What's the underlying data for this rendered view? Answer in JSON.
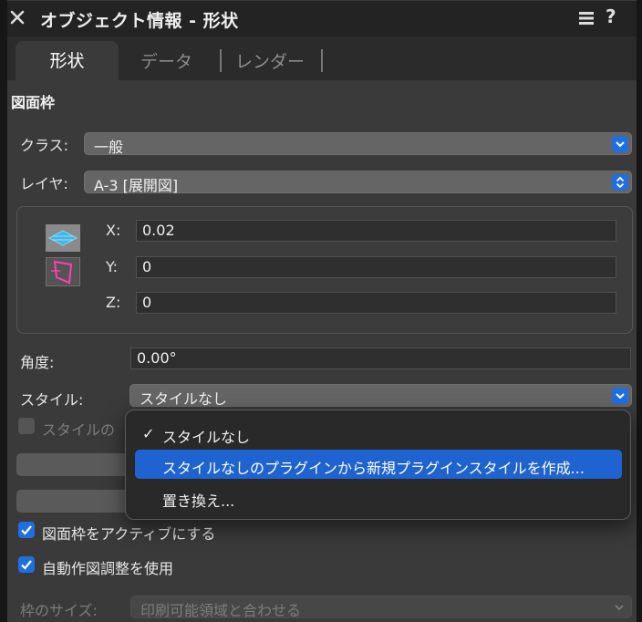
{
  "window": {
    "title": "オブジェクト情報 - 形状"
  },
  "tabs": [
    {
      "label": "形状"
    },
    {
      "label": "データ"
    },
    {
      "label": "レンダー"
    }
  ],
  "section": {
    "title": "図面枠"
  },
  "class_field": {
    "label": "クラス:",
    "value": "一般"
  },
  "layer_field": {
    "label": "レイヤ:",
    "value": "A-3 [展開図]"
  },
  "coords": {
    "x": {
      "label": "X:",
      "value": "0.02"
    },
    "y": {
      "label": "Y:",
      "value": "0"
    },
    "z": {
      "label": "Z:",
      "value": "0"
    }
  },
  "angle": {
    "label": "角度:",
    "value": "0.00°"
  },
  "style": {
    "label": "スタイル:",
    "value": "スタイルなし"
  },
  "style_checkbox": {
    "label": "スタイルの"
  },
  "dropdown": {
    "check": "✓",
    "items": [
      "スタイルなし",
      "スタイルなしのプラグインから新規プラグインスタイルを作成...",
      "置き換え..."
    ]
  },
  "checkboxes": {
    "active_frame": "図面枠をアクティブにする",
    "auto_adjust": "自動作図調整を使用"
  },
  "frame_size": {
    "label": "枠のサイズ:",
    "value": "印刷可能領域と合わせる"
  },
  "colors": {
    "accent": "#1f6fe0",
    "panel": "#3a3a3a",
    "highlight": "#1f63d0"
  }
}
